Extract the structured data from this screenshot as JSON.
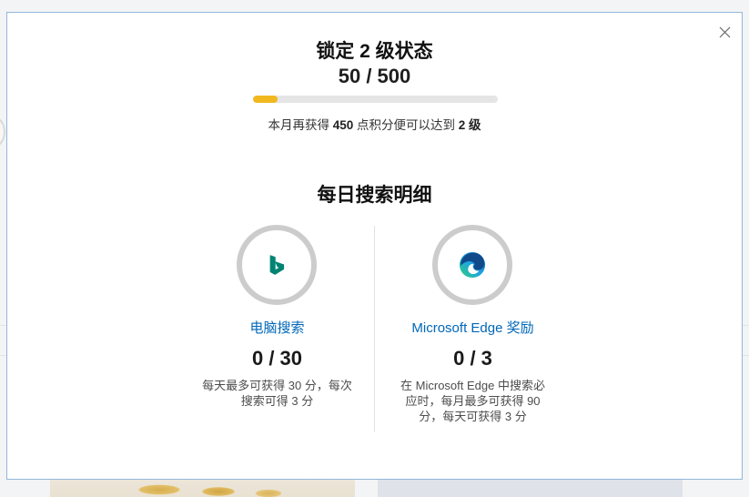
{
  "level": {
    "title": "锁定 2 级状态",
    "points_text": "50 / 500",
    "progress": 0.1,
    "message_prefix": "本月再获得 ",
    "message_points": "450",
    "message_middle": " 点积分便可以达到 ",
    "message_level": "2 级"
  },
  "daily": {
    "heading": "每日搜索明细",
    "cards": [
      {
        "icon": "bing-icon",
        "label": "电脑搜索",
        "points_text": "0 / 30",
        "progress": 0,
        "description_lines": [
          "每天最多可获得 30 分，每次",
          "搜索可得 3 分"
        ]
      },
      {
        "icon": "edge-icon",
        "label": "Microsoft Edge 奖励",
        "points_text": "0 / 3",
        "progress": 0,
        "description_lines": [
          "在 Microsoft Edge 中搜索必",
          "应时，每月最多可获得 90",
          "分，每天可获得 3 分"
        ]
      }
    ]
  },
  "icons": {
    "close": "close-icon",
    "bing": "bing-icon",
    "edge": "edge-icon"
  },
  "colors": {
    "link": "#0067b8",
    "progress_fill": "#f2b81f",
    "progress_track": "#e5e5e5",
    "ring": "#cccccc",
    "border": "#93b7da",
    "bing": "#008373"
  }
}
